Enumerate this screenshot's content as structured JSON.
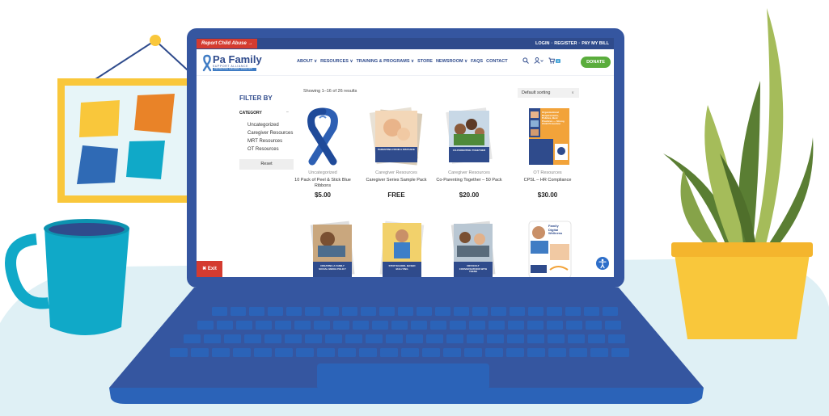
{
  "topbar": {
    "report_label": "Report Child Abuse  →",
    "login": "LOGIN",
    "register": "REGISTER",
    "pay_bill": "PAY MY BILL",
    "sep": "·"
  },
  "logo": {
    "title": "Pa Family",
    "subtitle": "SUPPORT ALLIANCE",
    "tagline": "PROTECTING CHILDREN, SINCE 1975"
  },
  "nav": {
    "items": [
      "ABOUT ∨",
      "RESOURCES ∨",
      "TRAINING & PROGRAMS ∨",
      "STORE",
      "NEWSROOM ∨",
      "FAQS",
      "CONTACT"
    ]
  },
  "header": {
    "cart_count": "0",
    "donate": "DONATE"
  },
  "sidebar": {
    "filter_title": "FILTER BY",
    "category_heading": "CATEGORY",
    "toggle": "–",
    "categories": [
      "Uncategorized",
      "Caregiver Resources",
      "MRT Resources",
      "OT Resources"
    ],
    "reset": "Reset"
  },
  "shop": {
    "results": "Showing 1–16 of 26 results",
    "sorting": "Default sorting",
    "sort_arrow": "∨"
  },
  "products": [
    {
      "category": "Uncategorized",
      "name": "10 Pack of Peel & Stick Blue Ribbons",
      "price": "$5.00"
    },
    {
      "category": "Caregiver Resources",
      "name": "Caregiver Series Sample Pack",
      "price": "FREE"
    },
    {
      "category": "Caregiver Resources",
      "name": "Co-Parenting Together – 50 Pack",
      "price": "$20.00"
    },
    {
      "category": "OT Resources",
      "name": "CPSL – HR Compliance",
      "price": "$30.00"
    }
  ],
  "posters": {
    "p1": "PARENTING FROM A DISTANCE",
    "p2": "CO-PARENTING TOGETHER",
    "p3": "Organizational Requirements, Policies, Best Practices — Strong Child Protection",
    "p4": "CREATING A FAMILY SOCIAL MEDIA POLICY",
    "p5": "STOP SCHOOL BASED BULLYING",
    "p6": "DIFFICULT CONVERSATIONS WITH TEENS",
    "p7": "Family Digital Wellness"
  },
  "exit_label": "✖ Exit",
  "colors": {
    "brand_blue": "#2f4b8c",
    "alert_red": "#d43b30",
    "donate_green": "#5aad3c",
    "laptop_blue": "#3556a0"
  },
  "icons": {
    "search": "search-icon",
    "user": "user-icon",
    "cart": "cart-icon",
    "accessibility": "accessibility-icon",
    "ribbon": "ribbon-icon"
  }
}
